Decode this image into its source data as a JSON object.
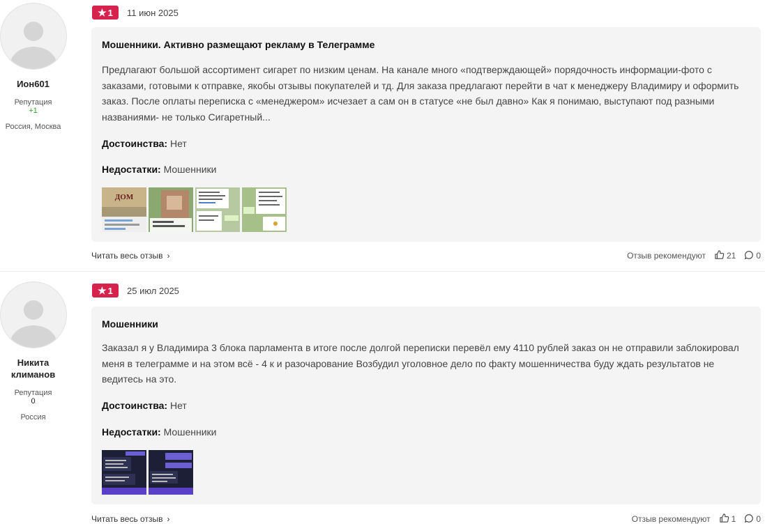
{
  "reviews": [
    {
      "author": {
        "name": "Ион601",
        "reputation_label": "Репутация",
        "reputation": "+1",
        "location": "Россия, Москва"
      },
      "rating": "1",
      "date": "11 июн 2025",
      "title": "Мошенники. Активно размещают рекламу в Телеграмме",
      "text": "Предлагают большой ассортимент сигарет по низким ценам. На канале много «подтверждающей» порядочность информации-фото с заказами, готовыми к отправке, якобы отзывы покупателей и тд. Для заказа предлагают перейти в чат к менеджеру Владимиру и оформить заказ. После оплаты переписка с «менеджером» исчезает а сам он в статусе «не был давно» Как я понимаю, выступают под разными названиями- не только Сигаретный...",
      "pros_label": "Достоинства:",
      "pros": "Нет",
      "cons_label": "Недостатки:",
      "cons": "Мошенники",
      "thumb_text": "ДОМ",
      "read_more": "Читать весь отзыв",
      "recommend_label": "Отзыв рекомендуют",
      "likes": "21",
      "comments": "0"
    },
    {
      "author": {
        "name": "Никита климанов",
        "reputation_label": "Репутация",
        "reputation": "0",
        "location": "Россия"
      },
      "rating": "1",
      "date": "25 июл 2025",
      "title": "Мошенники",
      "text": "Заказал я у Владимира 3 блока парламента в итоге после долгой переписки перевёл ему 4110 рублей заказ он не отправили заблокировал меня в телеграмме и на этом всё - 4 к и разочарование Возбудил уголовное дело по факту мошенничества буду ждать результатов не ведитесь на это.",
      "pros_label": "Достоинства:",
      "pros": "Нет",
      "cons_label": "Недостатки:",
      "cons": "Мошенники",
      "read_more": "Читать весь отзыв",
      "recommend_label": "Отзыв рекомендуют",
      "likes": "1",
      "comments": "0"
    }
  ],
  "colors": {
    "badge": "#d5234e",
    "card_bg": "#f4f4f4",
    "rep_positive": "#2e9e2e"
  }
}
